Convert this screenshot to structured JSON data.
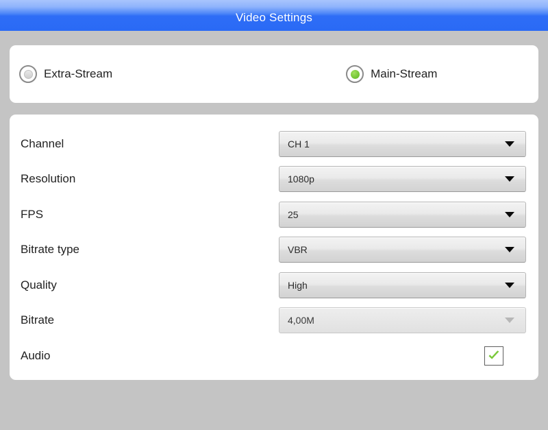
{
  "window": {
    "title": "Video Settings"
  },
  "stream_selector": {
    "options": [
      {
        "label": "Extra-Stream",
        "selected": false
      },
      {
        "label": "Main-Stream",
        "selected": true
      }
    ]
  },
  "settings": {
    "rows": [
      {
        "label": "Channel",
        "control": "dropdown",
        "value": "CH 1",
        "enabled": true
      },
      {
        "label": "Resolution",
        "control": "dropdown",
        "value": "1080p",
        "enabled": true
      },
      {
        "label": "FPS",
        "control": "dropdown",
        "value": "25",
        "enabled": true
      },
      {
        "label": "Bitrate type",
        "control": "dropdown",
        "value": "VBR",
        "enabled": true
      },
      {
        "label": "Quality",
        "control": "dropdown",
        "value": "High",
        "enabled": true
      },
      {
        "label": "Bitrate",
        "control": "dropdown",
        "value": "4,00M",
        "enabled": false
      },
      {
        "label": "Audio",
        "control": "checkbox",
        "value": "",
        "checked": true
      }
    ]
  },
  "icons": {
    "dropdown_caret": "chevron-down-icon",
    "checkmark": "checkmark-icon",
    "radio_on": "radio-selected-icon",
    "radio_off": "radio-unselected-icon"
  },
  "colors": {
    "titlebar_top": "#a8c4fd",
    "titlebar_bottom": "#2a6af5",
    "page_background": "#c4c4c4",
    "card_background": "#ffffff",
    "accent_green": "#7ac93a",
    "text_primary": "#222222"
  }
}
